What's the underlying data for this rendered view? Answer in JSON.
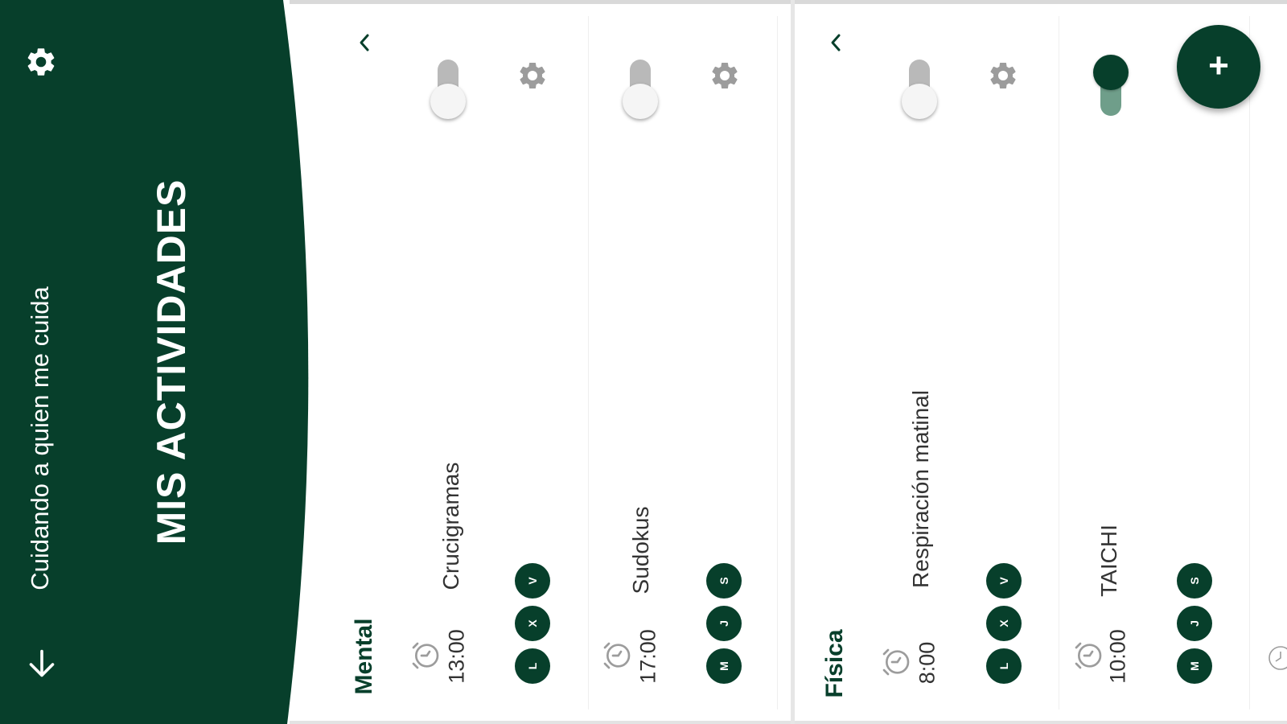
{
  "colors": {
    "brand": "#073f2b",
    "toggle_off": "#b9b9b9",
    "toggle_on_track": "#6f9e8a",
    "gear": "#9c9c9c"
  },
  "header": {
    "subtitle": "Cuidando a quien me cuida",
    "title": "MIS ACTIVIDADES",
    "icons": {
      "settings": "gear-icon",
      "scroll": "arrow-down-icon"
    }
  },
  "sections": [
    {
      "label": "Mental",
      "activities": [
        {
          "name": "Crucigramas",
          "time": "13:00",
          "enabled": false,
          "days": [
            "L",
            "X",
            "V"
          ]
        },
        {
          "name": "Sudokus",
          "time": "17:00",
          "enabled": false,
          "days": [
            "M",
            "J",
            "S"
          ]
        }
      ]
    },
    {
      "label": "Física",
      "activities": [
        {
          "name": "Respiración matinal",
          "time": "8:00",
          "enabled": false,
          "days": [
            "L",
            "X",
            "V"
          ]
        },
        {
          "name": "TAICHI",
          "time": "10:00",
          "enabled": true,
          "days": [
            "M",
            "J",
            "S"
          ]
        }
      ]
    }
  ],
  "fab": {
    "label": "+"
  }
}
